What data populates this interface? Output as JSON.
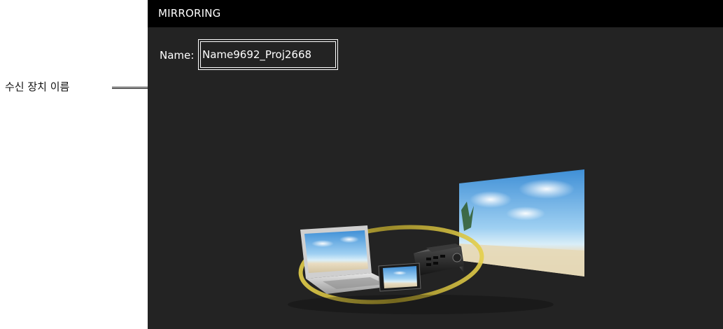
{
  "callout": {
    "label": "수신 장치 이름"
  },
  "screen": {
    "title": "MIRRORING",
    "name_label": "Name:",
    "name_value": "Name9692_Proj2668"
  },
  "colors": {
    "title_bar": "#000000",
    "screen_background": "#232323",
    "text": "#ffffff",
    "orbit_ring": "#c9b53a"
  },
  "illustration": {
    "icons": [
      "laptop-icon",
      "smartphone-icon",
      "projector-icon",
      "projection-screen-icon"
    ]
  }
}
